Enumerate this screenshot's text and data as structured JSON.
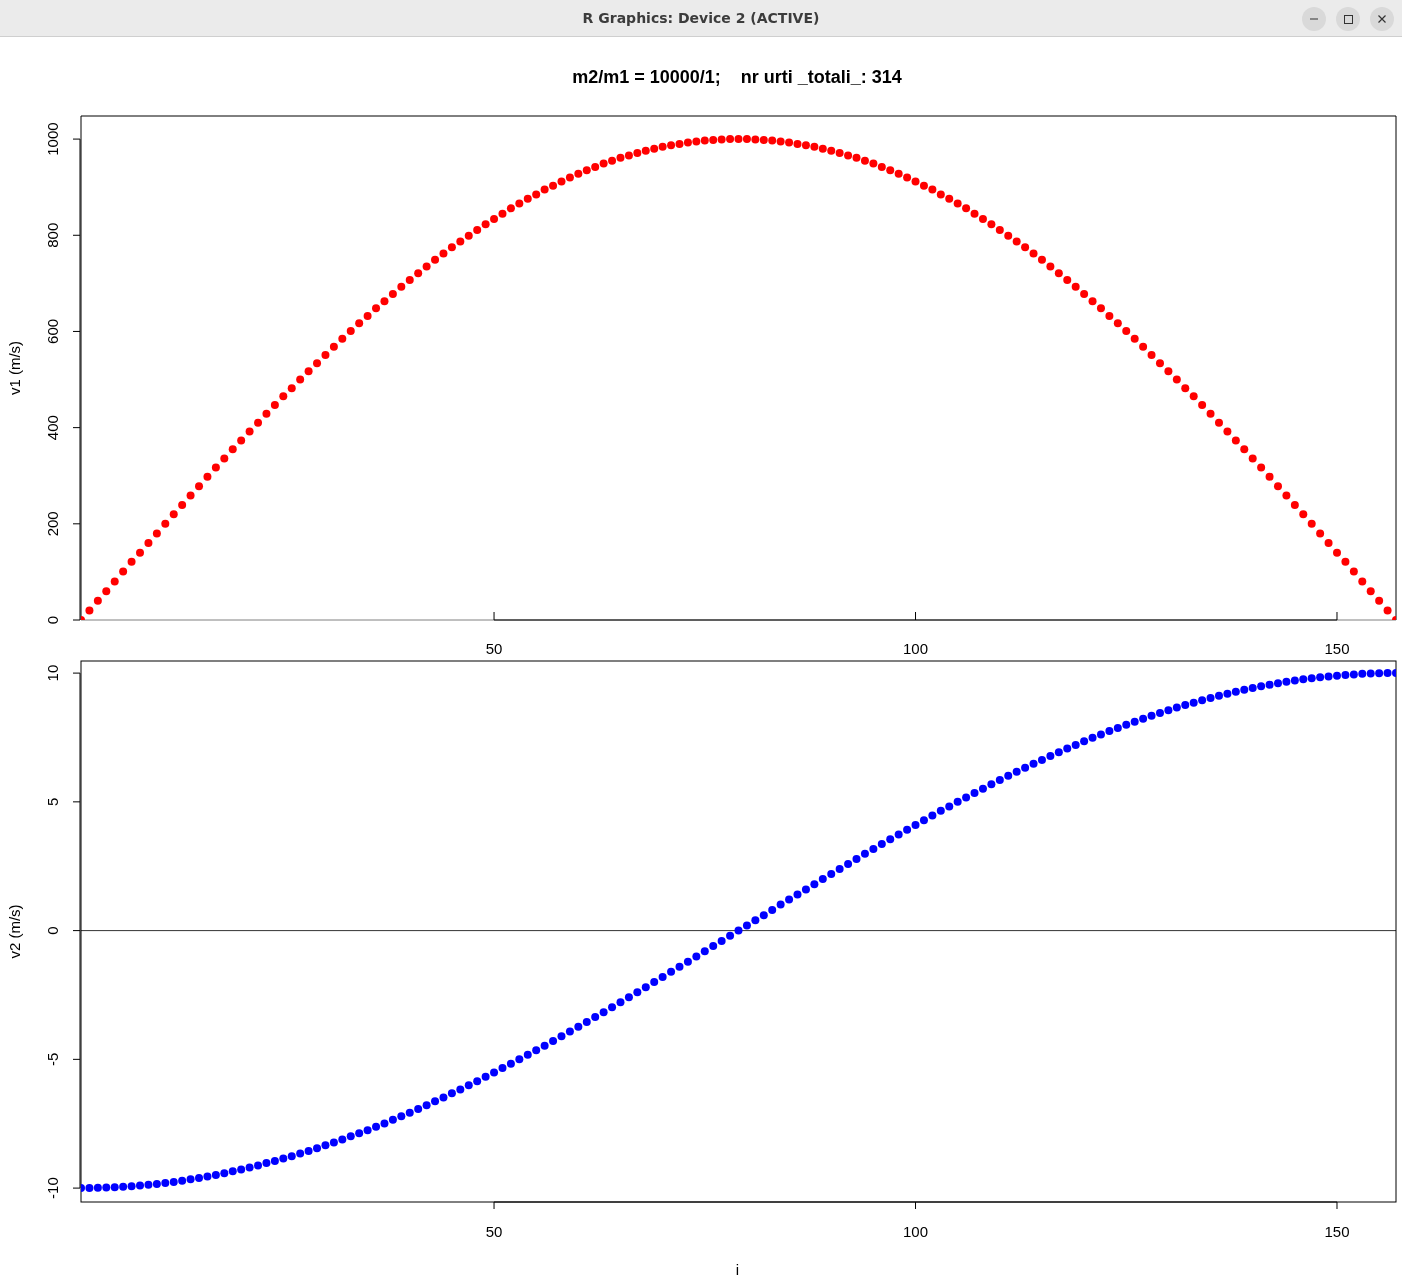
{
  "window": {
    "title": "R Graphics: Device 2 (ACTIVE)"
  },
  "plots": [
    {
      "chart_data": {
        "type": "scatter",
        "title": "m2/m1 = 10000/1;    nr urti _totali_: 314",
        "ylabel": "v1 (m/s)",
        "xlim": [
          1,
          157
        ],
        "ylim": [
          0,
          1048
        ],
        "xticks": [
          50,
          100,
          150
        ],
        "yticks": [
          0,
          200,
          400,
          600,
          800,
          1000
        ],
        "x": [
          1,
          2,
          3,
          4,
          5,
          6,
          7,
          8,
          9,
          10,
          11,
          12,
          13,
          14,
          15,
          16,
          17,
          18,
          19,
          20,
          21,
          22,
          23,
          24,
          25,
          26,
          27,
          28,
          29,
          30,
          31,
          32,
          33,
          34,
          35,
          36,
          37,
          38,
          39,
          40,
          41,
          42,
          43,
          44,
          45,
          46,
          47,
          48,
          49,
          50,
          51,
          52,
          53,
          54,
          55,
          56,
          57,
          58,
          59,
          60,
          61,
          62,
          63,
          64,
          65,
          66,
          67,
          68,
          69,
          70,
          71,
          72,
          73,
          74,
          75,
          76,
          77,
          78,
          79,
          80,
          81,
          82,
          83,
          84,
          85,
          86,
          87,
          88,
          89,
          90,
          91,
          92,
          93,
          94,
          95,
          96,
          97,
          98,
          99,
          100,
          101,
          102,
          103,
          104,
          105,
          106,
          107,
          108,
          109,
          110,
          111,
          112,
          113,
          114,
          115,
          116,
          117,
          118,
          119,
          120,
          121,
          122,
          123,
          124,
          125,
          126,
          127,
          128,
          129,
          130,
          131,
          132,
          133,
          134,
          135,
          136,
          137,
          138,
          139,
          140,
          141,
          142,
          143,
          144,
          145,
          146,
          147,
          148,
          149,
          150,
          151,
          152,
          153,
          154,
          155,
          156,
          157
        ],
        "series": [
          {
            "color": "#ff0000",
            "values": [
              0,
              20,
              40,
              60,
              80,
              101,
              121,
              140,
              160,
              180,
              200,
              220,
              239,
              259,
              278,
              298,
              317,
              336,
              355,
              373,
              392,
              410,
              429,
              447,
              465,
              482,
              500,
              517,
              534,
              551,
              568,
              585,
              601,
              617,
              632,
              648,
              663,
              678,
              693,
              707,
              721,
              735,
              749,
              762,
              775,
              787,
              799,
              811,
              823,
              834,
              845,
              856,
              866,
              876,
              885,
              895,
              903,
              912,
              920,
              928,
              935,
              942,
              949,
              955,
              961,
              966,
              971,
              976,
              980,
              984,
              987,
              990,
              993,
              995,
              997,
              998,
              999,
              1000,
              1000,
              1000,
              999,
              998,
              997,
              995,
              993,
              990,
              987,
              984,
              980,
              976,
              971,
              966,
              961,
              955,
              949,
              942,
              935,
              928,
              920,
              912,
              903,
              895,
              885,
              876,
              866,
              856,
              845,
              834,
              823,
              811,
              799,
              787,
              775,
              762,
              749,
              735,
              721,
              707,
              693,
              678,
              663,
              648,
              632,
              617,
              601,
              585,
              568,
              551,
              534,
              517,
              500,
              482,
              465,
              447,
              429,
              410,
              392,
              373,
              355,
              336,
              317,
              298,
              278,
              259,
              239,
              220,
              200,
              180,
              160,
              140,
              121,
              101,
              80,
              60,
              40,
              20,
              0
            ]
          }
        ],
        "ref_lines": [
          {
            "axis": "y",
            "value": 0
          }
        ]
      }
    },
    {
      "chart_data": {
        "type": "scatter",
        "xlabel": "i",
        "ylabel": "v2 (m/s)",
        "xlim": [
          1,
          157
        ],
        "ylim": [
          -10.54,
          10.47
        ],
        "xticks": [
          50,
          100,
          150
        ],
        "yticks": [
          -10,
          -5,
          0,
          5,
          10
        ],
        "x": [
          1,
          2,
          3,
          4,
          5,
          6,
          7,
          8,
          9,
          10,
          11,
          12,
          13,
          14,
          15,
          16,
          17,
          18,
          19,
          20,
          21,
          22,
          23,
          24,
          25,
          26,
          27,
          28,
          29,
          30,
          31,
          32,
          33,
          34,
          35,
          36,
          37,
          38,
          39,
          40,
          41,
          42,
          43,
          44,
          45,
          46,
          47,
          48,
          49,
          50,
          51,
          52,
          53,
          54,
          55,
          56,
          57,
          58,
          59,
          60,
          61,
          62,
          63,
          64,
          65,
          66,
          67,
          68,
          69,
          70,
          71,
          72,
          73,
          74,
          75,
          76,
          77,
          78,
          79,
          80,
          81,
          82,
          83,
          84,
          85,
          86,
          87,
          88,
          89,
          90,
          91,
          92,
          93,
          94,
          95,
          96,
          97,
          98,
          99,
          100,
          101,
          102,
          103,
          104,
          105,
          106,
          107,
          108,
          109,
          110,
          111,
          112,
          113,
          114,
          115,
          116,
          117,
          118,
          119,
          120,
          121,
          122,
          123,
          124,
          125,
          126,
          127,
          128,
          129,
          130,
          131,
          132,
          133,
          134,
          135,
          136,
          137,
          138,
          139,
          140,
          141,
          142,
          143,
          144,
          145,
          146,
          147,
          148,
          149,
          150,
          151,
          152,
          153,
          154,
          155,
          156,
          157
        ],
        "series": [
          {
            "color": "#0000ff",
            "values": [
              -10,
              -10,
              -9.99,
              -9.98,
              -9.97,
              -9.95,
              -9.93,
              -9.9,
              -9.87,
              -9.84,
              -9.8,
              -9.76,
              -9.71,
              -9.66,
              -9.61,
              -9.55,
              -9.49,
              -9.42,
              -9.35,
              -9.28,
              -9.2,
              -9.12,
              -9.03,
              -8.95,
              -8.85,
              -8.76,
              -8.66,
              -8.56,
              -8.45,
              -8.34,
              -8.23,
              -8.11,
              -7.99,
              -7.87,
              -7.75,
              -7.62,
              -7.49,
              -7.35,
              -7.21,
              -7.07,
              -6.93,
              -6.78,
              -6.63,
              -6.48,
              -6.32,
              -6.17,
              -6.01,
              -5.85,
              -5.68,
              -5.51,
              -5.34,
              -5.17,
              -5,
              -4.82,
              -4.65,
              -4.47,
              -4.29,
              -4.1,
              -3.92,
              -3.73,
              -3.55,
              -3.36,
              -3.17,
              -2.98,
              -2.78,
              -2.59,
              -2.39,
              -2.2,
              -2,
              -1.8,
              -1.6,
              -1.4,
              -1.21,
              -1.01,
              -0.8,
              -0.6,
              -0.4,
              -0.2,
              0,
              0.2,
              0.4,
              0.6,
              0.8,
              1.01,
              1.21,
              1.4,
              1.6,
              1.8,
              2,
              2.2,
              2.39,
              2.59,
              2.78,
              2.98,
              3.17,
              3.36,
              3.55,
              3.73,
              3.92,
              4.1,
              4.29,
              4.47,
              4.65,
              4.82,
              5,
              5.17,
              5.34,
              5.51,
              5.68,
              5.85,
              6.01,
              6.17,
              6.32,
              6.48,
              6.63,
              6.78,
              6.93,
              7.07,
              7.21,
              7.35,
              7.49,
              7.62,
              7.75,
              7.87,
              7.99,
              8.11,
              8.23,
              8.34,
              8.45,
              8.56,
              8.66,
              8.76,
              8.85,
              8.95,
              9.03,
              9.12,
              9.2,
              9.28,
              9.35,
              9.42,
              9.49,
              9.55,
              9.61,
              9.66,
              9.71,
              9.76,
              9.8,
              9.84,
              9.87,
              9.9,
              9.93,
              9.95,
              9.97,
              9.98,
              9.99,
              10,
              10
            ]
          }
        ],
        "ref_lines": [
          {
            "axis": "y",
            "value": 0
          }
        ]
      }
    }
  ]
}
